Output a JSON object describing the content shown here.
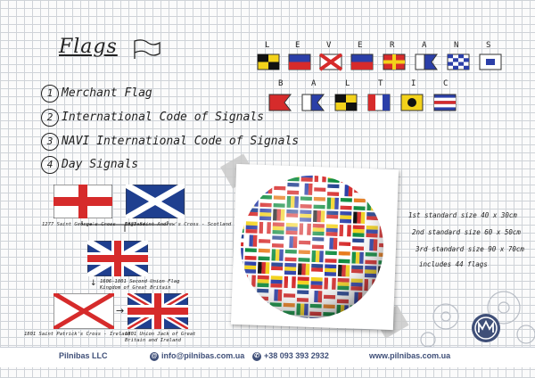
{
  "title": "Flags",
  "list": [
    {
      "num": "1",
      "text": "Merchant Flag"
    },
    {
      "num": "2",
      "text": "International Code of Signals"
    },
    {
      "num": "3",
      "text": "NAVI International Code of Signals"
    },
    {
      "num": "4",
      "text": "Day Signals"
    }
  ],
  "signal_word_1": [
    "L",
    "E",
    "V",
    "E",
    "R",
    "A",
    "N",
    "S"
  ],
  "signal_word_2": [
    "B",
    "A",
    "L",
    "T",
    "I",
    "C"
  ],
  "flag_captions": {
    "england": "1277 Saint George's Cross - England",
    "scotland": "1823 Saint Andrew's Cross - Scotland",
    "union_1606": "1606-1801 Second Union Flag Kingdom of Great Britain",
    "ireland": "1801 Saint Patrick's Cross - Ireland",
    "union_1801": "1801 Union Jack of Great Britain and Ireland"
  },
  "specs": [
    "1st standard size 40 x 30cm",
    "2nd standard size 60 x 50cm",
    "3rd standard size 90 x 70cm",
    "includes 44 flags"
  ],
  "footer": {
    "company": "Pilnibas LLC",
    "email": "info@pilnibas.com.ua",
    "phone": "+38 093 393 2932",
    "website": "www.pilnibas.com.ua"
  },
  "colors": {
    "footer_text": "#3f4f78",
    "grid": "#cfd3d8"
  }
}
